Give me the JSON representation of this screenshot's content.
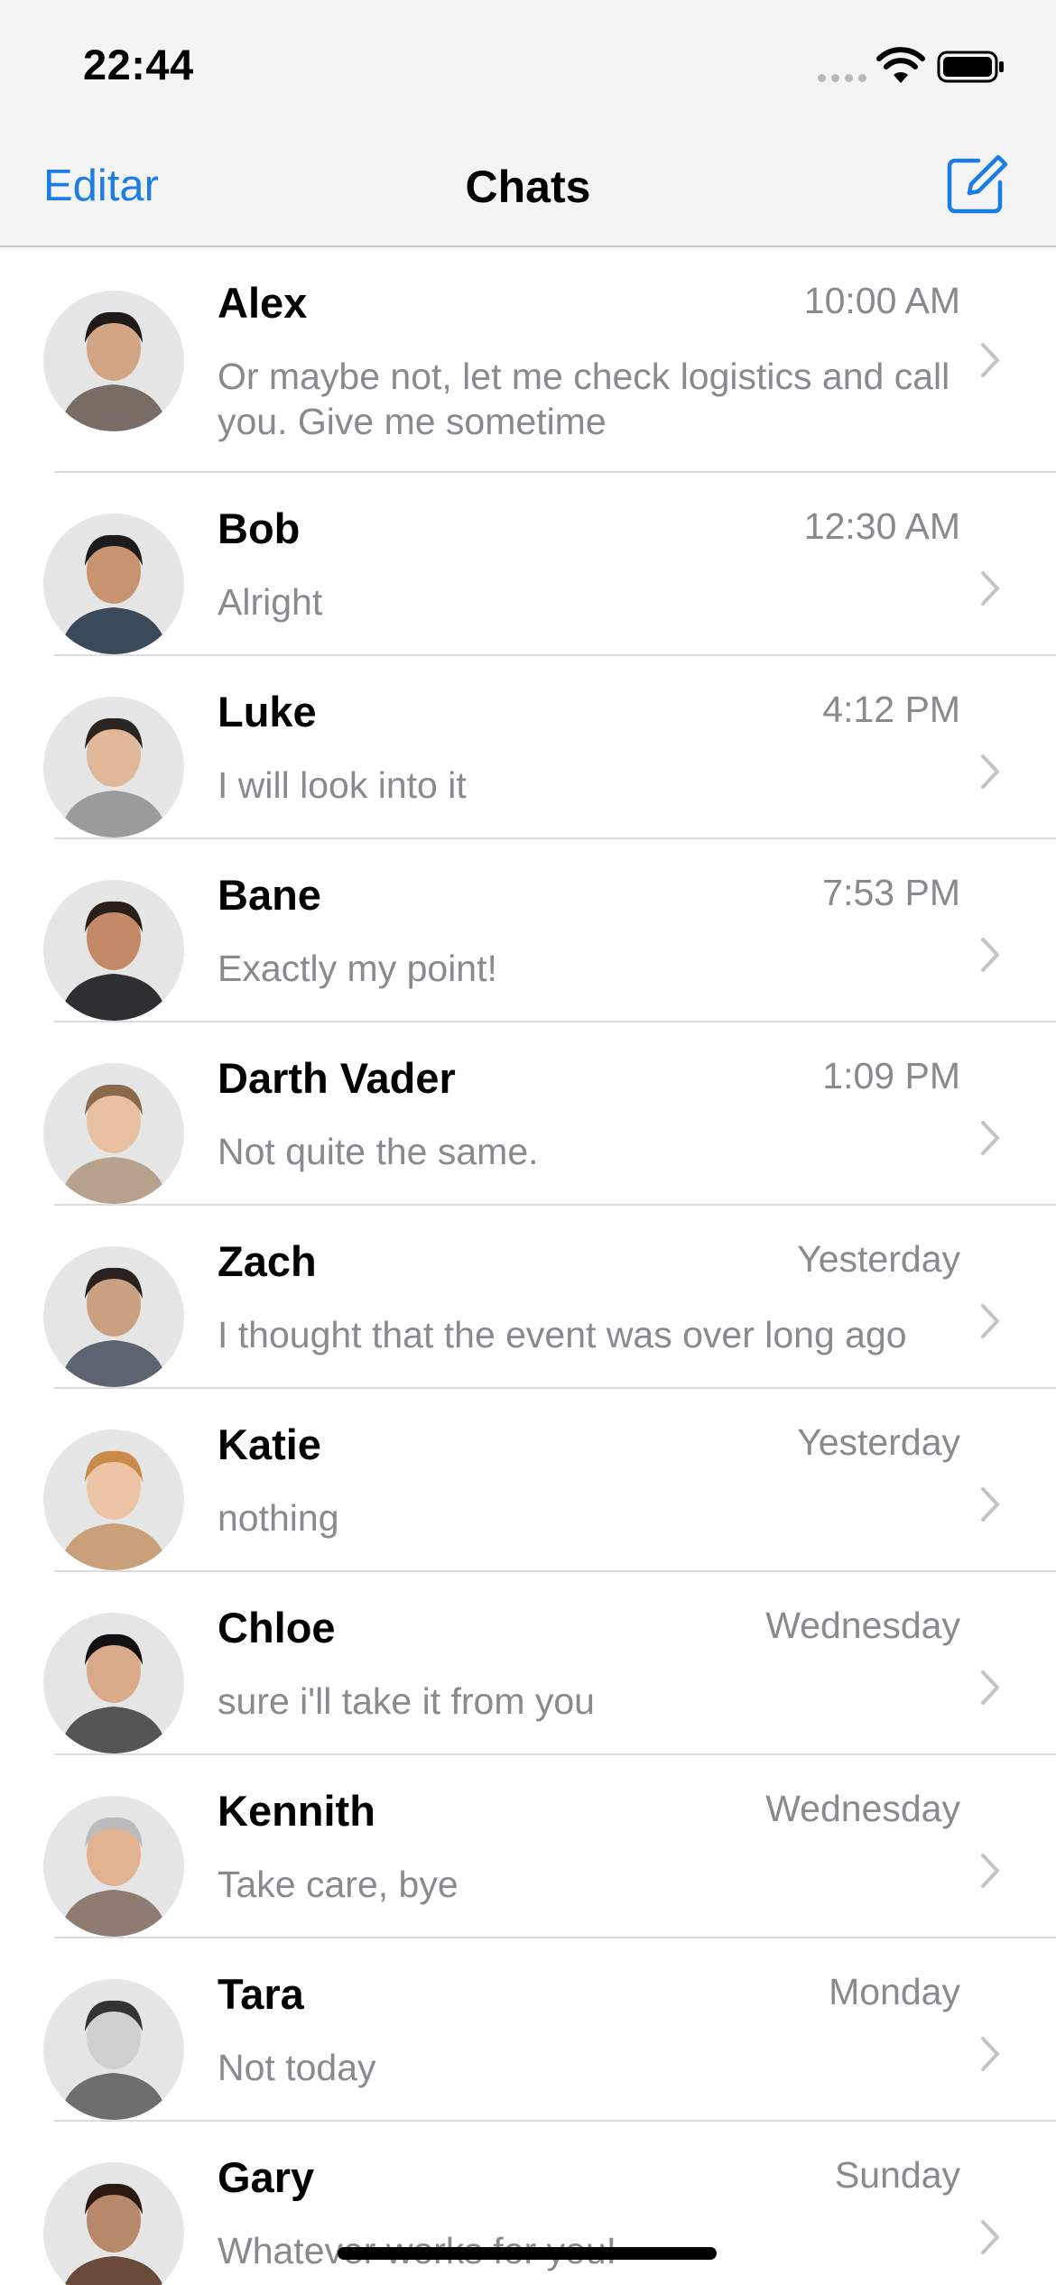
{
  "status_bar": {
    "time": "22:44"
  },
  "nav": {
    "edit_label": "Editar",
    "title": "Chats"
  },
  "accent_color": "#1a7ee6",
  "chats": [
    {
      "name": "Alex",
      "time": "10:00 AM",
      "message": "Or maybe not, let me check logistics and call you. Give me sometime",
      "avatar_color": "#7a6d66"
    },
    {
      "name": "Bob",
      "time": "12:30 AM",
      "message": "Alright",
      "avatar_color": "#3b4a5a"
    },
    {
      "name": "Luke",
      "time": "4:12 PM",
      "message": "I will look into it",
      "avatar_color": "#9b9b9b"
    },
    {
      "name": "Bane",
      "time": "7:53 PM",
      "message": "Exactly my point!",
      "avatar_color": "#2f2f32"
    },
    {
      "name": "Darth Vader",
      "time": "1:09 PM",
      "message": "Not quite the same.",
      "avatar_color": "#b9a28d"
    },
    {
      "name": "Zach",
      "time": "Yesterday",
      "message": "I thought that the event was over long ago",
      "avatar_color": "#5b6470"
    },
    {
      "name": "Katie",
      "time": "Yesterday",
      "message": "nothing",
      "avatar_color": "#c9a07a"
    },
    {
      "name": "Chloe",
      "time": "Wednesday",
      "message": "sure i'll take it from you",
      "avatar_color": "#555555"
    },
    {
      "name": "Kennith",
      "time": "Wednesday",
      "message": "Take care, bye",
      "avatar_color": "#8e7c72"
    },
    {
      "name": "Tara",
      "time": "Monday",
      "message": "Not today",
      "avatar_color": "#6e6e6e"
    },
    {
      "name": "Gary",
      "time": "Sunday",
      "message": "Whatever works for you!",
      "avatar_color": "#6a4a3a"
    }
  ]
}
